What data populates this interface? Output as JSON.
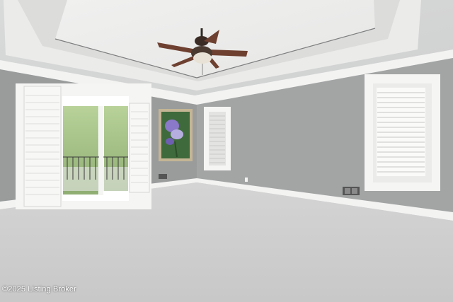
{
  "photo": {
    "watermark_text": "©2025 Listing Broker",
    "subject": "empty-bedroom-with-tray-ceiling",
    "wall_color": "#9c9e9e",
    "trim_color": "#f5f5f3",
    "carpet_color": "#cfcfcf",
    "fan_blade_color": "#6e4030"
  }
}
